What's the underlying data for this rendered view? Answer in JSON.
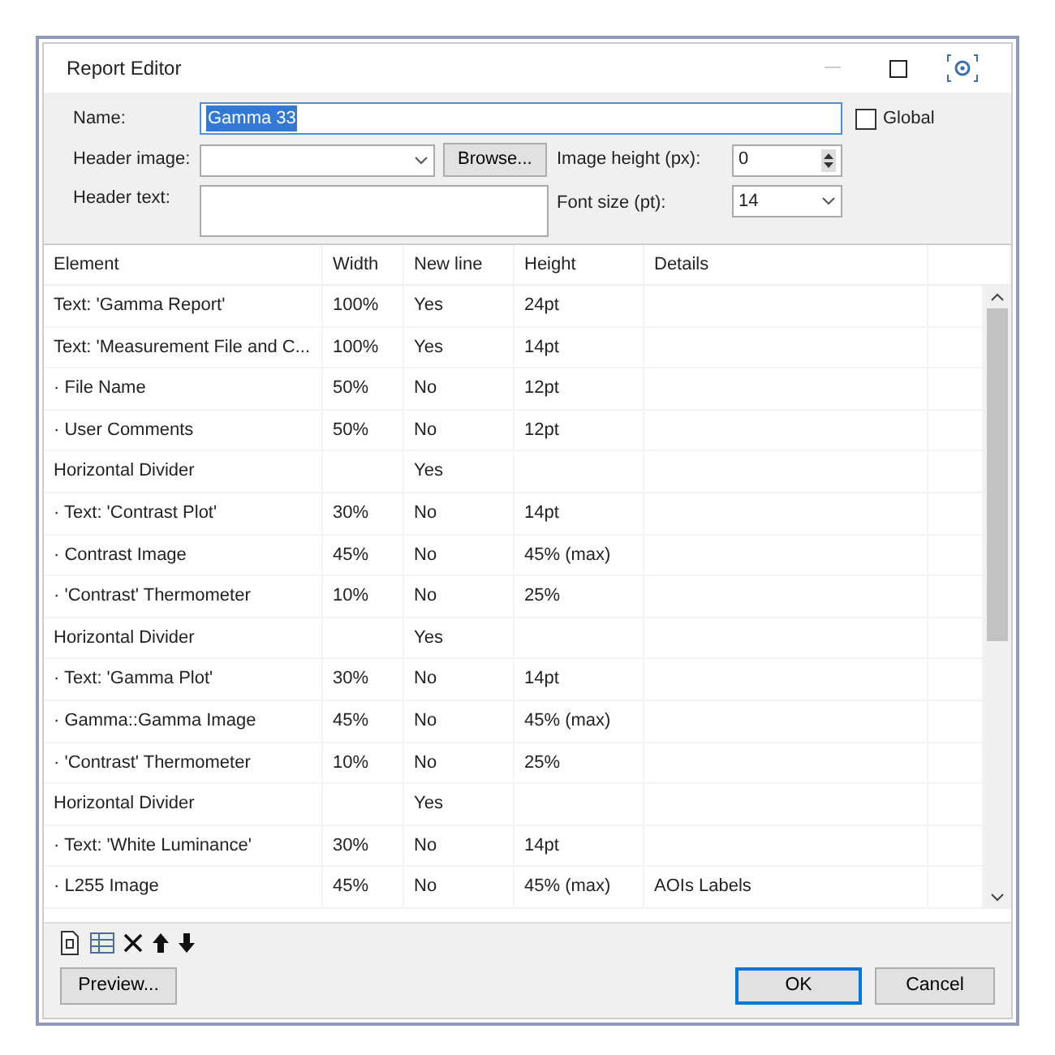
{
  "window": {
    "title": "Report Editor"
  },
  "form": {
    "name": {
      "label": "Name:",
      "value": "Gamma 33",
      "selected": true
    },
    "global": {
      "label": "Global",
      "checked": false
    },
    "header_image": {
      "label": "Header image:"
    },
    "browse": "Browse...",
    "image_height": {
      "label": "Image height (px):",
      "value": "0"
    },
    "header_text": {
      "label": "Header text:"
    },
    "font_size": {
      "label": "Font size (pt):",
      "value": "14"
    }
  },
  "table": {
    "columns": [
      "Element",
      "Width",
      "New line",
      "Height",
      "Details"
    ],
    "rows": [
      [
        "Text: 'Gamma Report'",
        "100%",
        "Yes",
        "24pt",
        ""
      ],
      [
        "Text: 'Measurement File and C...",
        "100%",
        "Yes",
        "14pt",
        ""
      ],
      [
        "· File Name",
        "50%",
        "No",
        "12pt",
        ""
      ],
      [
        "· User Comments",
        "50%",
        "No",
        "12pt",
        ""
      ],
      [
        "Horizontal Divider",
        "",
        "Yes",
        "",
        ""
      ],
      [
        "· Text: 'Contrast Plot'",
        "30%",
        "No",
        "14pt",
        ""
      ],
      [
        "· Contrast Image",
        "45%",
        "No",
        "45% (max)",
        ""
      ],
      [
        "· 'Contrast' Thermometer",
        "10%",
        "No",
        "25%",
        ""
      ],
      [
        "Horizontal Divider",
        "",
        "Yes",
        "",
        ""
      ],
      [
        "· Text: 'Gamma Plot'",
        "30%",
        "No",
        "14pt",
        ""
      ],
      [
        "· Gamma::Gamma Image",
        "45%",
        "No",
        "45% (max)",
        ""
      ],
      [
        "· 'Contrast' Thermometer",
        "10%",
        "No",
        "25%",
        ""
      ],
      [
        "Horizontal Divider",
        "",
        "Yes",
        "",
        ""
      ],
      [
        "· Text: 'White Luminance'",
        "30%",
        "No",
        "14pt",
        ""
      ],
      [
        "· L255 Image",
        "45%",
        "No",
        "45% (max)",
        "AOIs Labels"
      ]
    ]
  },
  "buttons": [
    {
      "label": "Preview...",
      "default": false
    },
    {
      "label": "OK",
      "default": true
    },
    {
      "label": "Cancel",
      "default": false
    }
  ]
}
